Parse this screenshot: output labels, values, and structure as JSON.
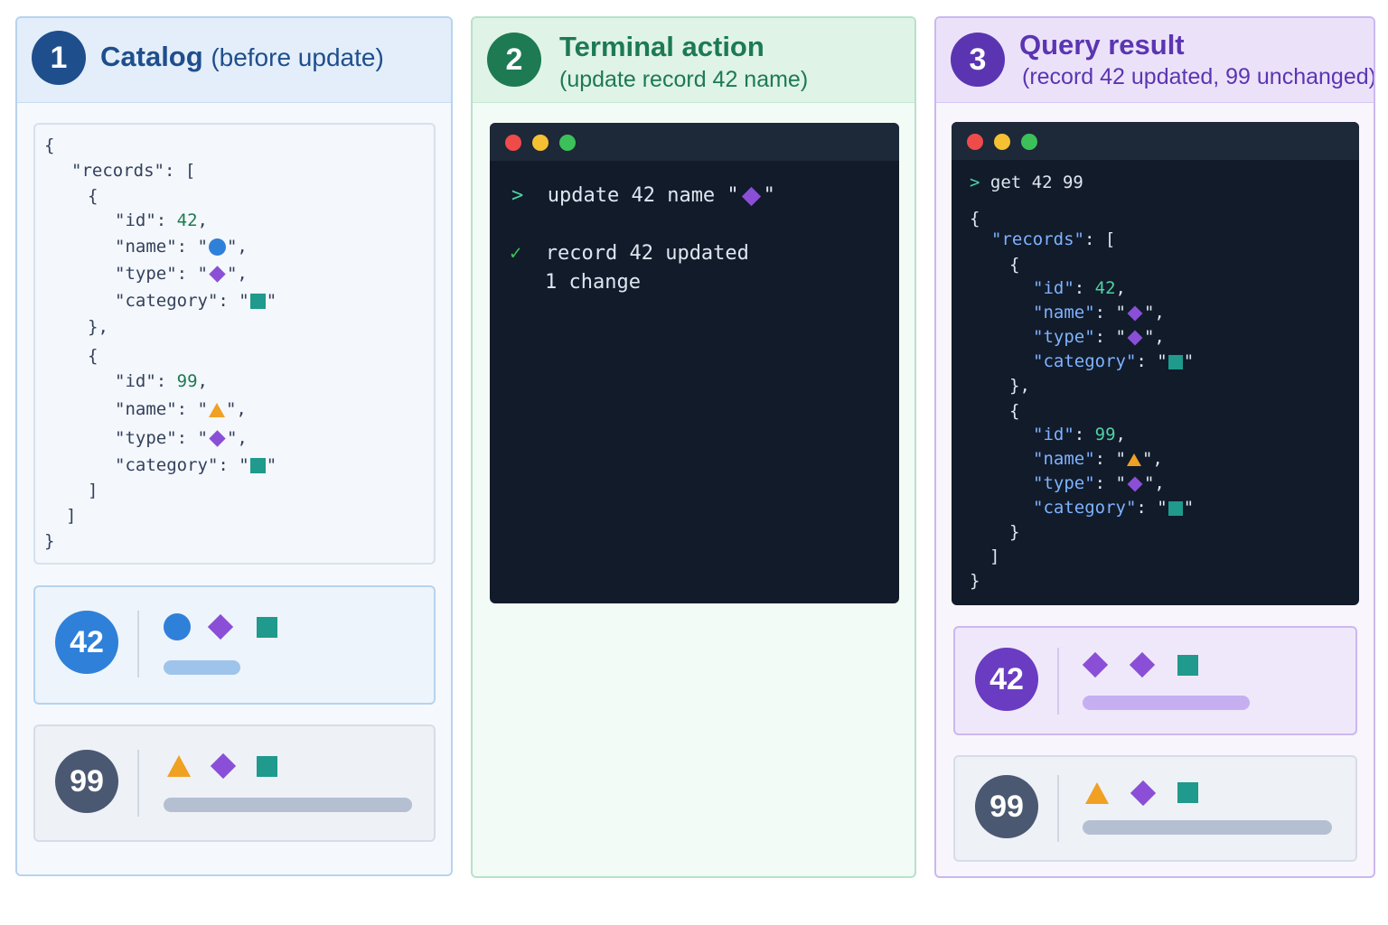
{
  "panels": {
    "catalog": {
      "step": "1",
      "title": "Catalog",
      "title_paren": "(before update)",
      "json_lines": {
        "open": "{",
        "records_key": "\"records\": [",
        "obj_open": "{",
        "id_key": "\"id\": ",
        "name_key": "\"name\": ",
        "type_key": "\"type\": ",
        "category_key": "\"category\": ",
        "obj_close_comma": "},",
        "obj_close": "]",
        "arr_close": "]",
        "close": "}"
      },
      "records": [
        {
          "id": "42",
          "name_icon": "circle-icon",
          "type_icon": "diamond-icon",
          "category_icon": "square-icon"
        },
        {
          "id": "99",
          "name_icon": "triangle-icon",
          "type_icon": "diamond-icon",
          "category_icon": "square-icon"
        }
      ],
      "cards": [
        {
          "id": "42",
          "icons": [
            "circle-icon",
            "diamond-icon",
            "square-icon"
          ]
        },
        {
          "id": "99",
          "icons": [
            "triangle-icon",
            "diamond-icon",
            "square-icon"
          ]
        }
      ]
    },
    "terminal": {
      "step": "2",
      "title": "Terminal action",
      "subtitle": "(update record 42 name)",
      "prompt": ">",
      "command": "update 42 name \"",
      "command_icon": "diamond-icon",
      "command_end": "\"",
      "check_mark": "✓",
      "output_line1": "record 42 updated",
      "output_line2": "1 change"
    },
    "result": {
      "step": "3",
      "title": "Query result",
      "subtitle": "(record 42 updated, 99 unchanged)",
      "prompt": ">",
      "command": "get 42 99",
      "json_lines": {
        "open": "{",
        "records_key": "\"records\"",
        "records_rest": ": [",
        "obj_open": "{",
        "id_key": "\"id\"",
        "name_key": "\"name\"",
        "type_key": "\"type\"",
        "category_key": "\"category\"",
        "obj_close_comma": "},",
        "obj_close": "}",
        "arr_close": "]",
        "close": "}"
      },
      "records": [
        {
          "id": "42",
          "name_icon": "diamond-icon",
          "type_icon": "diamond-icon",
          "category_icon": "square-icon"
        },
        {
          "id": "99",
          "name_icon": "triangle-icon",
          "type_icon": "diamond-icon",
          "category_icon": "square-icon"
        }
      ],
      "cards": [
        {
          "id": "42",
          "icons": [
            "diamond-icon",
            "diamond-icon",
            "square-icon"
          ]
        },
        {
          "id": "99",
          "icons": [
            "triangle-icon",
            "diamond-icon",
            "square-icon"
          ]
        }
      ]
    }
  },
  "colors": {
    "blue": "#2f80d9",
    "purple": "#8a4fd6",
    "teal": "#1f9a8c",
    "orange": "#f0a023",
    "catalog_accent": "#1f4e8c",
    "terminal_accent": "#1d7a52",
    "result_accent": "#5b35b1",
    "slate_badge": "#4a5872"
  }
}
